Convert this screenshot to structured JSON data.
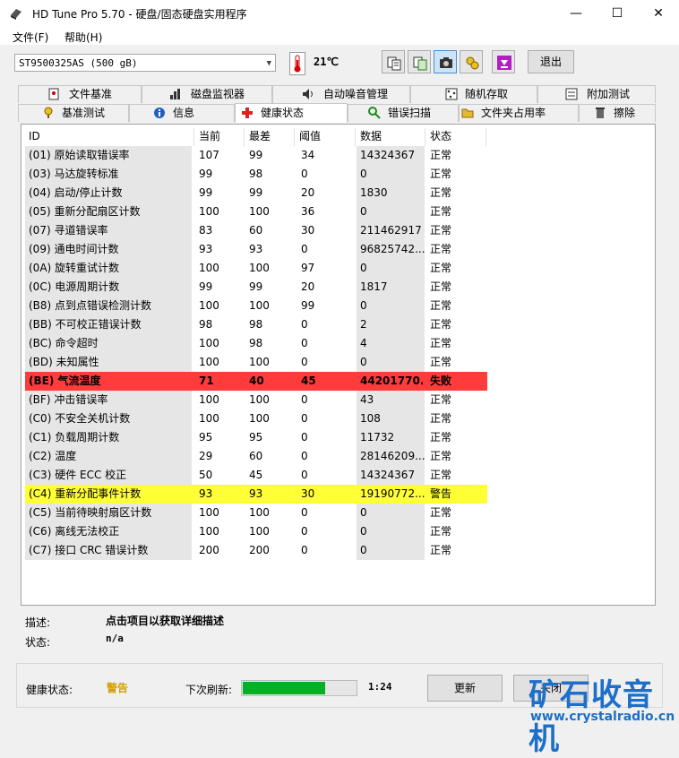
{
  "window": {
    "title": "HD Tune Pro 5.70 - 硬盘/固态硬盘实用程序"
  },
  "menu": {
    "file": "文件(F)",
    "help": "帮助(H)"
  },
  "toolbar": {
    "drive": "ST9500325AS (500 gB)",
    "temperature": "21℃",
    "exit_label": "退出",
    "buttons": [
      "copy-text-icon",
      "copy-info-icon",
      "screenshot-icon",
      "options-icon",
      "save-icon"
    ]
  },
  "tabs": {
    "row1": [
      {
        "label": "文件基准",
        "icon": "file-benchmark-icon"
      },
      {
        "label": "磁盘监视器",
        "icon": "disk-monitor-icon"
      },
      {
        "label": "自动噪音管理",
        "icon": "noise-management-icon"
      },
      {
        "label": "随机存取",
        "icon": "random-access-icon"
      },
      {
        "label": "附加测试",
        "icon": "extra-tests-icon"
      }
    ],
    "row2": [
      {
        "label": "基准测试",
        "icon": "benchmark-icon"
      },
      {
        "label": "信息",
        "icon": "info-icon"
      },
      {
        "label": "健康状态",
        "icon": "health-icon"
      },
      {
        "label": "错误扫描",
        "icon": "error-scan-icon"
      },
      {
        "label": "文件夹占用率",
        "icon": "folder-usage-icon"
      },
      {
        "label": "擦除",
        "icon": "erase-icon"
      }
    ],
    "active": "健康状态"
  },
  "table": {
    "headers": [
      "ID",
      "当前",
      "最差",
      "阈值",
      "数据",
      "状态"
    ],
    "rows": [
      {
        "id": "(01) 原始读取错误率",
        "cur": "107",
        "worst": "99",
        "thr": "34",
        "data": "14324367",
        "status": "正常"
      },
      {
        "id": "(03) 马达旋转标准",
        "cur": "99",
        "worst": "98",
        "thr": "0",
        "data": "0",
        "status": "正常"
      },
      {
        "id": "(04) 启动/停止计数",
        "cur": "99",
        "worst": "99",
        "thr": "20",
        "data": "1830",
        "status": "正常"
      },
      {
        "id": "(05) 重新分配扇区计数",
        "cur": "100",
        "worst": "100",
        "thr": "36",
        "data": "0",
        "status": "正常"
      },
      {
        "id": "(07) 寻道错误率",
        "cur": "83",
        "worst": "60",
        "thr": "30",
        "data": "211462917",
        "status": "正常"
      },
      {
        "id": "(09) 通电时间计数",
        "cur": "93",
        "worst": "93",
        "thr": "0",
        "data": "96825742...",
        "status": "正常"
      },
      {
        "id": "(0A) 旋转重试计数",
        "cur": "100",
        "worst": "100",
        "thr": "97",
        "data": "0",
        "status": "正常"
      },
      {
        "id": "(0C) 电源周期计数",
        "cur": "99",
        "worst": "99",
        "thr": "20",
        "data": "1817",
        "status": "正常"
      },
      {
        "id": "(B8) 点到点错误检测计数",
        "cur": "100",
        "worst": "100",
        "thr": "99",
        "data": "0",
        "status": "正常"
      },
      {
        "id": "(BB) 不可校正错误计数",
        "cur": "98",
        "worst": "98",
        "thr": "0",
        "data": "2",
        "status": "正常"
      },
      {
        "id": "(BC) 命令超时",
        "cur": "100",
        "worst": "98",
        "thr": "0",
        "data": "4",
        "status": "正常"
      },
      {
        "id": "(BD) 未知属性",
        "cur": "100",
        "worst": "100",
        "thr": "0",
        "data": "0",
        "status": "正常"
      },
      {
        "id": "(BE) 气流温度",
        "cur": "71",
        "worst": "40",
        "thr": "45",
        "data": "44201770...",
        "status": "失败",
        "state": "fail"
      },
      {
        "id": "(BF) 冲击错误率",
        "cur": "100",
        "worst": "100",
        "thr": "0",
        "data": "43",
        "status": "正常"
      },
      {
        "id": "(C0) 不安全关机计数",
        "cur": "100",
        "worst": "100",
        "thr": "0",
        "data": "108",
        "status": "正常"
      },
      {
        "id": "(C1) 负载周期计数",
        "cur": "95",
        "worst": "95",
        "thr": "0",
        "data": "11732",
        "status": "正常"
      },
      {
        "id": "(C2) 温度",
        "cur": "29",
        "worst": "60",
        "thr": "0",
        "data": "28146209...",
        "status": "正常"
      },
      {
        "id": "(C3) 硬件 ECC 校正",
        "cur": "50",
        "worst": "45",
        "thr": "0",
        "data": "14324367",
        "status": "正常"
      },
      {
        "id": "(C4) 重新分配事件计数",
        "cur": "93",
        "worst": "93",
        "thr": "30",
        "data": "19190772...",
        "status": "警告",
        "state": "warn"
      },
      {
        "id": "(C5) 当前待映射扇区计数",
        "cur": "100",
        "worst": "100",
        "thr": "0",
        "data": "0",
        "status": "正常"
      },
      {
        "id": "(C6) 离线无法校正",
        "cur": "100",
        "worst": "100",
        "thr": "0",
        "data": "0",
        "status": "正常"
      },
      {
        "id": "(C7) 接口 CRC 错误计数",
        "cur": "200",
        "worst": "200",
        "thr": "0",
        "data": "0",
        "status": "正常"
      }
    ]
  },
  "details": {
    "desc_label": "描述:",
    "desc_value": "点击项目以获取详细描述",
    "state_label": "状态:",
    "state_value": "n/a"
  },
  "status": {
    "health_label": "健康状态:",
    "health_value": "警告",
    "refresh_label": "下次刷新:",
    "progress_fraction": 0.73,
    "countdown": "1:24",
    "update_label": "更新",
    "close_label": "关闭"
  },
  "watermark": {
    "text": "矿石收音机",
    "url": "www.crystalradio.cn"
  },
  "colors": {
    "fail_row": "#ff3b3b",
    "warn_row": "#ffff36",
    "progress": "#06b025",
    "health_warn": "#d4a000",
    "watermark": "#1d6fc8"
  }
}
